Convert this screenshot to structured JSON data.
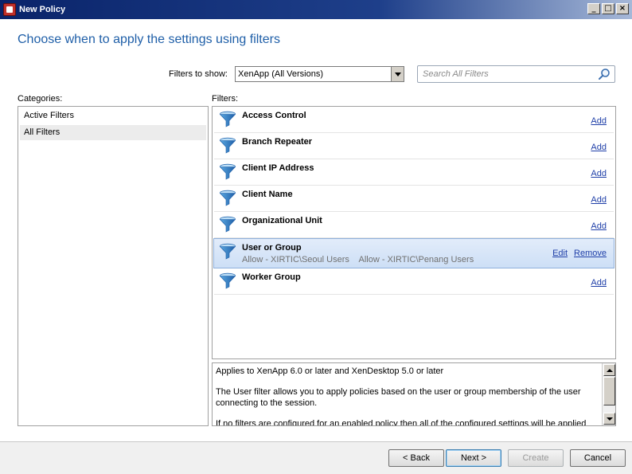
{
  "window": {
    "title": "New Policy"
  },
  "header": {
    "title": "Choose when to apply the settings using filters"
  },
  "toolbar": {
    "filters_to_show_label": "Filters to show:",
    "filters_to_show_value": "XenApp (All Versions)",
    "search_placeholder": "Search All Filters"
  },
  "categories": {
    "label": "Categories:",
    "items": [
      {
        "label": "Active Filters"
      },
      {
        "label": "All Filters"
      }
    ]
  },
  "filters": {
    "label": "Filters:",
    "items": [
      {
        "name": "Access Control",
        "action": "Add"
      },
      {
        "name": "Branch Repeater",
        "action": "Add"
      },
      {
        "name": "Client IP Address",
        "action": "Add"
      },
      {
        "name": "Client Name",
        "action": "Add"
      },
      {
        "name": "Organizational Unit",
        "action": "Add"
      },
      {
        "name": "User or Group",
        "detail": "Allow - XIRTIC\\Seoul Users    Allow - XIRTIC\\Penang Users",
        "edit": "Edit",
        "remove": "Remove"
      },
      {
        "name": "Worker Group",
        "action": "Add"
      }
    ]
  },
  "description": {
    "line1": "Applies to XenApp 6.0 or later and XenDesktop 5.0 or later",
    "line2": "The User filter allows you to apply policies based on the user or group membership of the user connecting to the session.",
    "line3": "If no filters are configured for an enabled policy then all of the configured settings will be applied"
  },
  "footer": {
    "back": "< Back",
    "next": "Next >",
    "create": "Create",
    "cancel": "Cancel"
  }
}
